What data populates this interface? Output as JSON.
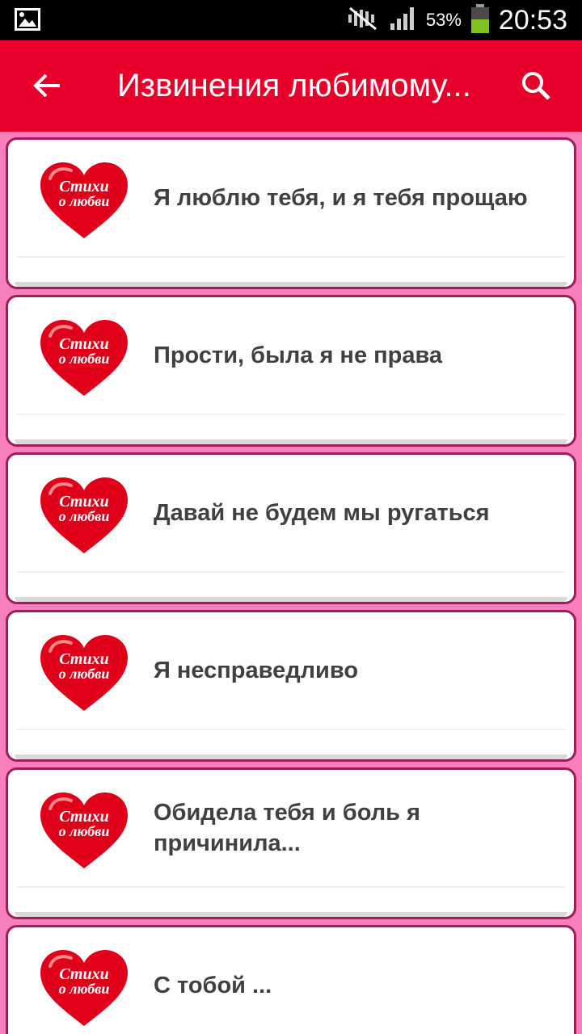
{
  "status_bar": {
    "icons": [
      "image-icon",
      "mute-icon",
      "signal-icon",
      "battery-icon"
    ],
    "battery_percent": "53%",
    "time": "20:53"
  },
  "app_bar": {
    "title": "Извинения любимому...",
    "back_icon": "arrow-left-icon",
    "search_icon": "search-icon"
  },
  "heart_badge": {
    "line1": "Стихи",
    "line2": "о любви"
  },
  "items": [
    {
      "title": "Я люблю тебя, и я тебя прощаю"
    },
    {
      "title": "Прости, была я не права"
    },
    {
      "title": "Давай не будем мы ругаться"
    },
    {
      "title": "Я несправедливо"
    },
    {
      "title": "Обидела тебя и боль я причинила..."
    },
    {
      "title": "С тобой ..."
    }
  ],
  "colors": {
    "app_bar": "#e8002a",
    "background": "#f77fbc",
    "card_border": "#9e1e5a",
    "heart": "#e0001a"
  }
}
